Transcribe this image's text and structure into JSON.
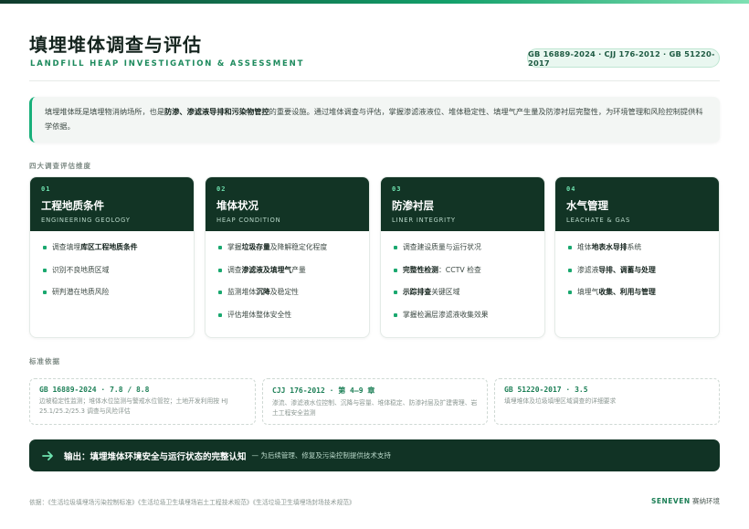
{
  "header": {
    "title": "填埋堆体调查与评估",
    "subtitle": "LANDFILL HEAP INVESTIGATION & ASSESSMENT",
    "standards_pill": "GB 16889-2024 · CJJ 176-2012 · GB 51220-2017"
  },
  "intro": {
    "part1": "填埋堆体既是填埋物消纳场所，也是",
    "bold": "防渗、渗滤液导排和污染物管控",
    "part2": "的重要设施。通过堆体调查与评估，掌握渗滤液液位、堆体稳定性、填埋气产生量及防渗衬层完整性，为环境管理和风险控制提供科学依据。"
  },
  "sections": {
    "dimensions_label": "四大调查评估维度",
    "standards_label": "标准依据"
  },
  "cards": [
    {
      "num": "01",
      "title": "工程地质条件",
      "en": "ENGINEERING GEOLOGY",
      "items": [
        {
          "pre": "调查填埋",
          "bold": "库区工程地质条件",
          "post": ""
        },
        {
          "pre": "识别不良地质区域",
          "bold": "",
          "post": ""
        },
        {
          "pre": "研判潜在地质风险",
          "bold": "",
          "post": ""
        }
      ]
    },
    {
      "num": "02",
      "title": "堆体状况",
      "en": "HEAP CONDITION",
      "items": [
        {
          "pre": "掌握",
          "bold": "垃圾存量",
          "post": "及降解稳定化程度"
        },
        {
          "pre": "调查",
          "bold": "渗滤液及填埋气",
          "post": "产量"
        },
        {
          "pre": "监测堆体",
          "bold": "沉降",
          "post": "及稳定性"
        },
        {
          "pre": "评估堆体整体安全性",
          "bold": "",
          "post": ""
        }
      ]
    },
    {
      "num": "03",
      "title": "防渗衬层",
      "en": "LINER INTEGRITY",
      "items": [
        {
          "pre": "调查建设质量与运行状况",
          "bold": "",
          "post": ""
        },
        {
          "pre": "",
          "bold": "完整性检测",
          "post": "：CCTV 检查"
        },
        {
          "pre": "",
          "bold": "示踪排查",
          "post": "关键区域"
        },
        {
          "pre": "掌握检漏层渗滤液收集效果",
          "bold": "",
          "post": ""
        }
      ]
    },
    {
      "num": "04",
      "title": "水气管理",
      "en": "LEACHATE & GAS",
      "items": [
        {
          "pre": "堆体",
          "bold": "地表水导排",
          "post": "系统"
        },
        {
          "pre": "渗滤液",
          "bold": "导排、调蓄与处理",
          "post": ""
        },
        {
          "pre": "填埋气",
          "bold": "收集、利用与管理",
          "post": ""
        }
      ]
    }
  ],
  "standards": [
    {
      "code": "GB 16889-2024 · 7.8 / 8.8",
      "desc": "边坡稳定性监测；堆体水位监测与警戒水位管控；土地开发利用按 HJ 25.1/25.2/25.3 调查与风险评估"
    },
    {
      "code": "CJJ 176-2012 · 第 4–9 章",
      "desc": "渗流、渗滤液水位控制、沉降与容量、堆体稳定、防渗衬层及扩建需理、岩土工程安全监测"
    },
    {
      "code": "GB 51220-2017 · 3.5",
      "desc": "填埋堆体及垃圾填埋区域调查的详细要求"
    }
  ],
  "output": {
    "main": "输出：填埋堆体环境安全与运行状态的完整认知",
    "sub": "— 为后续管理、修复及污染控制提供技术支持",
    "icon": "arrow-right-icon"
  },
  "footer": {
    "references": "依据：《生活垃圾填埋场污染控制标准》《生活垃圾卫生填埋场岩土工程技术规范》《生活垃圾卫生填埋场封场技术规范》",
    "brand": "SENEVEN",
    "brand_cn": "赛纳环境"
  },
  "colors": {
    "accent": "#18b07a",
    "dark_green": "#123425",
    "label_green": "#1d8a5d"
  }
}
